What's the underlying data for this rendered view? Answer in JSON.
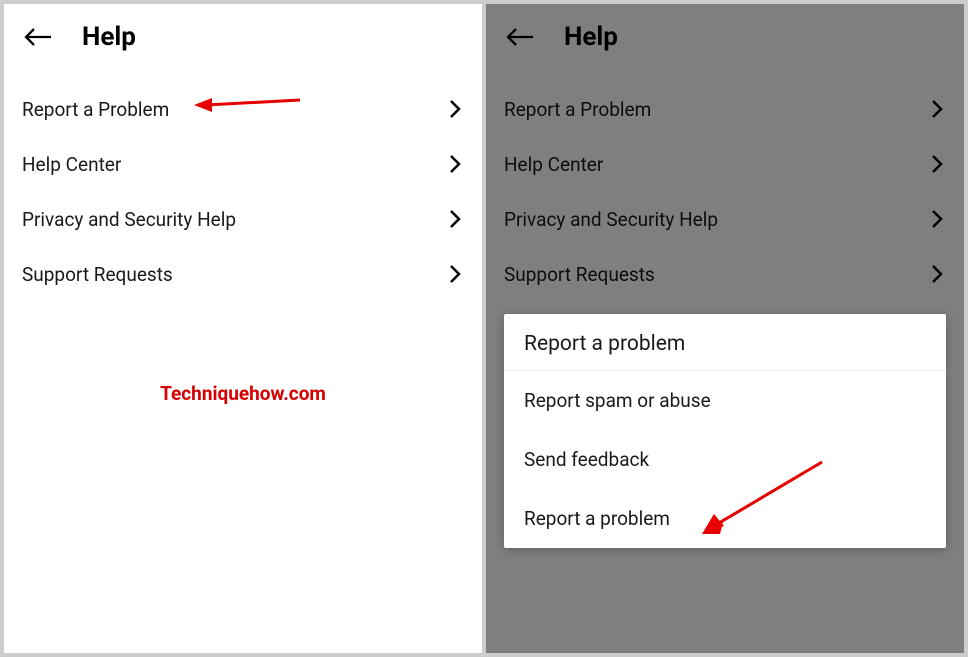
{
  "left": {
    "title": "Help",
    "items": [
      {
        "label": "Report a Problem"
      },
      {
        "label": "Help Center"
      },
      {
        "label": "Privacy and Security Help"
      },
      {
        "label": "Support Requests"
      }
    ],
    "watermark": "Techniquehow.com"
  },
  "right": {
    "title": "Help",
    "items": [
      {
        "label": "Report a Problem"
      },
      {
        "label": "Help Center"
      },
      {
        "label": "Privacy and Security Help"
      },
      {
        "label": "Support Requests"
      }
    ],
    "popup": {
      "title": "Report a problem",
      "options": [
        {
          "label": "Report spam or abuse"
        },
        {
          "label": "Send feedback"
        },
        {
          "label": "Report a problem"
        }
      ]
    }
  },
  "colors": {
    "annotation": "#e60000"
  }
}
